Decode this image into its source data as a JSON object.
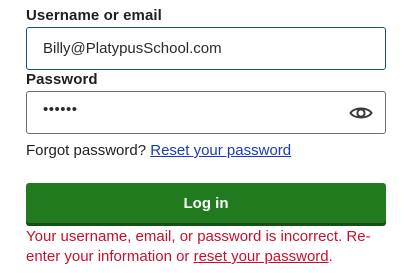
{
  "username": {
    "label": "Username or email",
    "value": "Billy@PlatypusSchool.com"
  },
  "password": {
    "label": "Password",
    "masked_value": "••••••",
    "toggle_icon": "eye-icon"
  },
  "forgot": {
    "prompt": "Forgot password?",
    "link": "Reset your password"
  },
  "login_button": "Log in",
  "error": {
    "text_before": "Your username, email, or password is incorrect. Re-enter your information or ",
    "link": "reset your password",
    "text_after": "."
  },
  "colors": {
    "primary_button": "#227a1e",
    "error": "#c8102e",
    "link": "#1a3bb5",
    "focus_border": "#1c4f7a"
  }
}
